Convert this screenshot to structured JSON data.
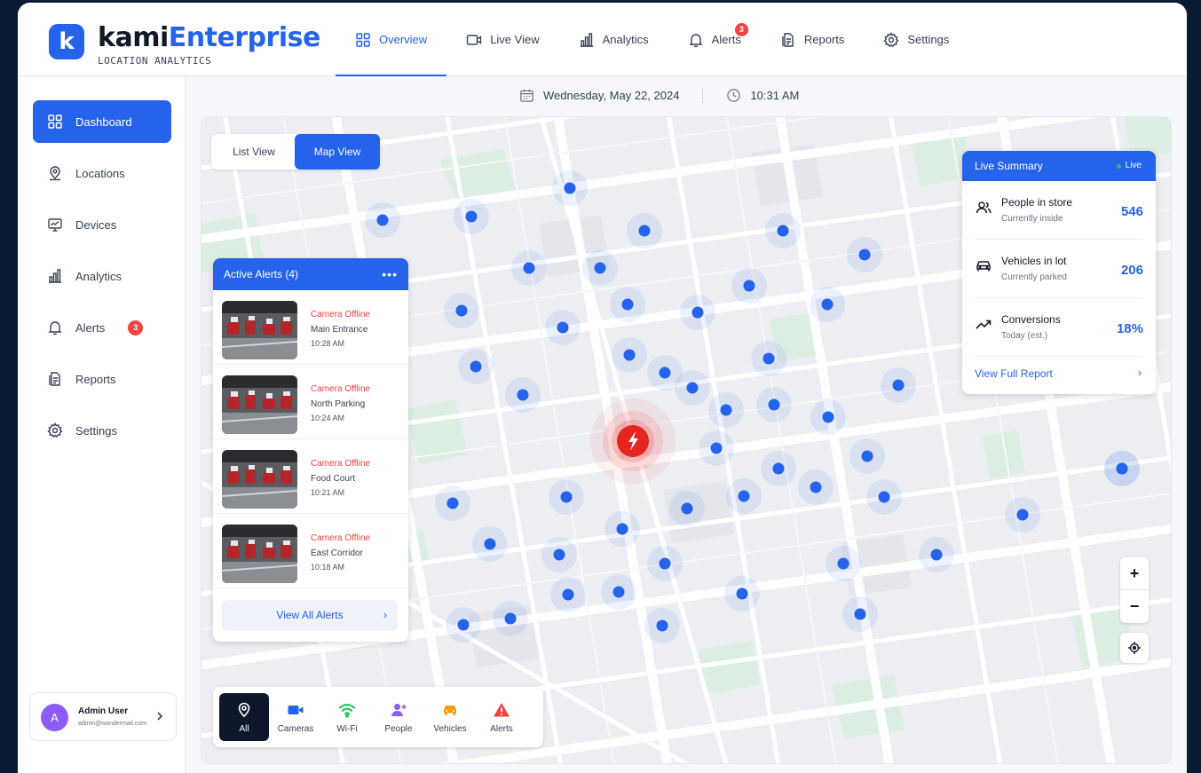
{
  "brand": {
    "logo_letter": "k",
    "name_part1": "kami",
    "name_part2": "Enterprise",
    "subtitle": "LOCATION ANALYTICS"
  },
  "topnav": {
    "items": [
      {
        "label": "Overview",
        "icon": "grid-icon",
        "active": true
      },
      {
        "label": "Live View",
        "icon": "video-icon"
      },
      {
        "label": "Analytics",
        "icon": "bar-chart-icon"
      },
      {
        "label": "Alerts",
        "icon": "bell-icon",
        "badge": "3"
      },
      {
        "label": "Reports",
        "icon": "document-icon"
      },
      {
        "label": "Settings",
        "icon": "gear-icon"
      }
    ]
  },
  "sidebar": {
    "items": [
      {
        "label": "Dashboard",
        "icon": "grid-icon",
        "active": true
      },
      {
        "label": "Locations",
        "icon": "location-pin-icon"
      },
      {
        "label": "Devices",
        "icon": "monitor-icon"
      },
      {
        "label": "Analytics",
        "icon": "bar-chart-icon"
      },
      {
        "label": "Alerts",
        "icon": "bell-icon",
        "badge": "3"
      },
      {
        "label": "Reports",
        "icon": "document-icon"
      },
      {
        "label": "Settings",
        "icon": "gear-icon"
      }
    ],
    "user": {
      "initial": "A",
      "name": "Admin User",
      "email": "admin@wondermail.com"
    }
  },
  "datebar": {
    "date": "Wednesday, May 22, 2024",
    "time": "10:31 AM"
  },
  "map": {
    "view_toggle": {
      "list": "List View",
      "map": "Map View",
      "active": "Map View"
    },
    "alerts_panel": {
      "title": "Active Alerts (4)",
      "more": "•••",
      "alerts": [
        {
          "status": "Camera Offline",
          "location": "Main Entrance",
          "time": "10:28 AM"
        },
        {
          "status": "Camera Offline",
          "location": "North Parking",
          "time": "10:24 AM"
        },
        {
          "status": "Camera Offline",
          "location": "Food Court",
          "time": "10:21 AM"
        },
        {
          "status": "Camera Offline",
          "location": "East Corridor",
          "time": "10:18 AM"
        }
      ],
      "footer": "View All Alerts"
    },
    "summary": {
      "title": "Live Summary",
      "live_label": "Live",
      "rows": [
        {
          "label": "People in store",
          "sub": "Currently inside",
          "value": "546",
          "icon": "people-icon"
        },
        {
          "label": "Vehicles in lot",
          "sub": "Currently parked",
          "value": "206",
          "icon": "car-icon"
        },
        {
          "label": "Conversions",
          "sub": "Today (est.)",
          "value": "18%",
          "icon": "trend-up-icon"
        }
      ],
      "link": "View Full Report"
    },
    "zoom_in": "+",
    "zoom_out": "−",
    "filters": [
      {
        "label": "All",
        "icon": "location-pin-icon",
        "color": "#ffffff",
        "active": true
      },
      {
        "label": "Cameras",
        "icon": "video-icon",
        "color": "#2563eb"
      },
      {
        "label": "Wi-Fi",
        "icon": "wifi-icon",
        "color": "#22c55e"
      },
      {
        "label": "People",
        "icon": "person-add-icon",
        "color": "#8b5cf6"
      },
      {
        "label": "Vehicles",
        "icon": "car-icon",
        "color": "#f59e0b"
      },
      {
        "label": "Alerts",
        "icon": "warning-icon",
        "color": "#ef4444"
      }
    ],
    "colors": {
      "marker": "#2563eb",
      "alert_marker": "#ef4444"
    }
  }
}
